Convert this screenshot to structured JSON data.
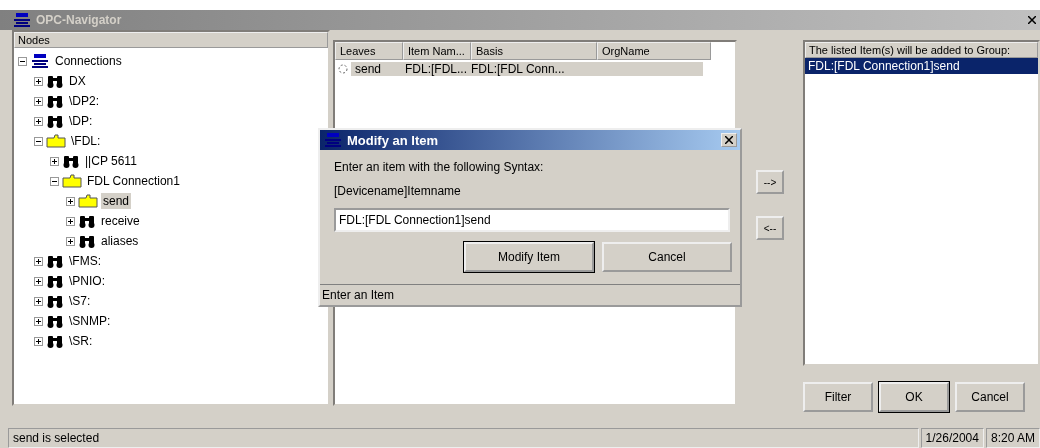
{
  "window": {
    "title": "OPC-Navigator"
  },
  "nodes_pane": {
    "header": "Nodes",
    "tree": [
      {
        "label": "Connections",
        "kind": "opc",
        "expanded": true,
        "selected": false,
        "children": [
          {
            "label": "DX",
            "kind": "binoculars",
            "expanded": false,
            "selected": false
          },
          {
            "label": "\\DP2:",
            "kind": "binoculars",
            "expanded": false,
            "selected": false
          },
          {
            "label": "\\DP:",
            "kind": "binoculars",
            "expanded": false,
            "selected": false
          },
          {
            "label": "\\FDL:",
            "kind": "folder",
            "expanded": true,
            "selected": false,
            "children": [
              {
                "label": "||CP 5611",
                "kind": "binoculars",
                "expanded": false,
                "selected": false
              },
              {
                "label": "FDL Connection1",
                "kind": "folder",
                "expanded": true,
                "selected": false,
                "children": [
                  {
                    "label": "send",
                    "kind": "folder",
                    "expanded": false,
                    "selected": true
                  },
                  {
                    "label": "receive",
                    "kind": "binoculars",
                    "expanded": false,
                    "selected": false
                  },
                  {
                    "label": "aliases",
                    "kind": "binoculars",
                    "expanded": false,
                    "selected": false
                  }
                ]
              }
            ]
          },
          {
            "label": "\\FMS:",
            "kind": "binoculars",
            "expanded": false,
            "selected": false
          },
          {
            "label": "\\PNIO:",
            "kind": "binoculars",
            "expanded": false,
            "selected": false
          },
          {
            "label": "\\S7:",
            "kind": "binoculars",
            "expanded": false,
            "selected": false
          },
          {
            "label": "\\SNMP:",
            "kind": "binoculars",
            "expanded": false,
            "selected": false
          },
          {
            "label": "\\SR:",
            "kind": "binoculars",
            "expanded": false,
            "selected": false
          }
        ]
      }
    ]
  },
  "leaves": {
    "columns": [
      "Leaves",
      "Item Nam...",
      "Basis",
      "OrgName"
    ],
    "rows": [
      {
        "cells": [
          "send",
          "FDL:[FDL...",
          "FDL:[FDL Conn...",
          ""
        ],
        "selected": true
      }
    ]
  },
  "move_buttons": [
    {
      "label": "-->"
    },
    {
      "label": "<--"
    }
  ],
  "group_pane": {
    "header": "The listed Item(s) will be added to Group:",
    "items": [
      {
        "label": "FDL:[FDL Connection1]send",
        "selected": true
      }
    ]
  },
  "buttons": [
    {
      "label": "Filter",
      "default": false
    },
    {
      "label": "OK",
      "default": true
    },
    {
      "label": "Cancel",
      "default": false
    }
  ],
  "dialog": {
    "title": "Modify an Item",
    "prompt": "Enter an item with the following Syntax:",
    "syntax": "[Devicename]Itemname",
    "value": "FDL:[FDL Connection1]send",
    "buttons": [
      {
        "label": "Modify Item",
        "default": true
      },
      {
        "label": "Cancel",
        "default": false
      }
    ],
    "status": "Enter an Item"
  },
  "status_bar": {
    "message": "send is selected",
    "date": "1/26/2004",
    "time": "8:20 AM"
  }
}
